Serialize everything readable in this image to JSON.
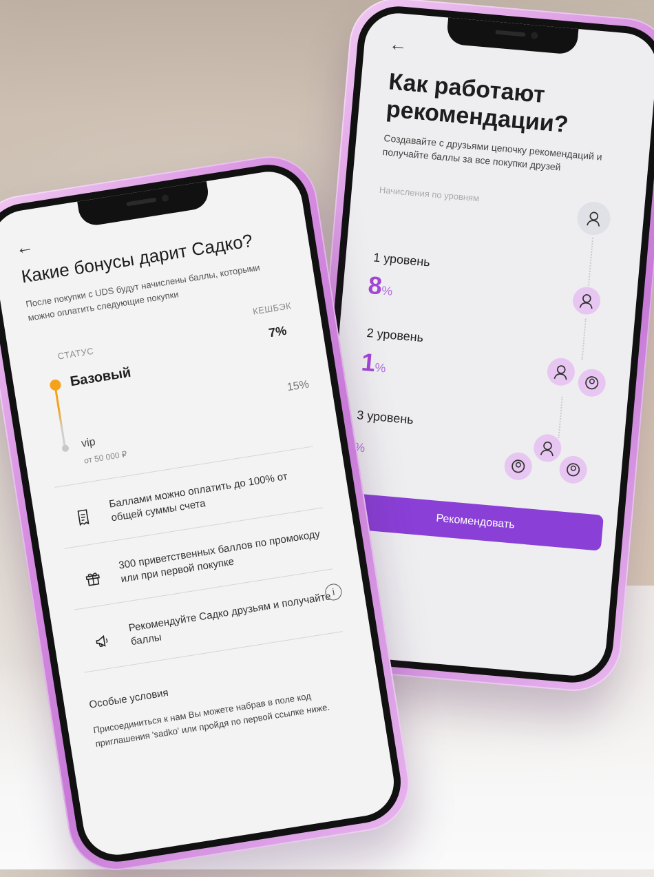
{
  "back_screen": {
    "back_icon": "arrow-left-icon",
    "title": "Как работают рекомендации?",
    "subtitle": "Создавайте с друзьями цепочку рекомендаций и получайте баллы за все покупки друзей",
    "levels_header": "Начисления по уровням",
    "levels": [
      {
        "name": "1 уровень",
        "value": "8",
        "unit": "%"
      },
      {
        "name": "2 уровень",
        "value": "1",
        "unit": "%"
      },
      {
        "name": "3 уровень",
        "value": "",
        "unit": "%"
      }
    ],
    "button_label": "Рекомендовать",
    "accent_color": "#8a3fd6"
  },
  "front_screen": {
    "back_icon": "arrow-left-icon",
    "title": "Какие бонусы дарит Садко?",
    "subtitle": "После покупки с UDS будут начислены баллы, которыми можно оплатить следующие покупки",
    "status_header": "СТАТУС",
    "cashback_header": "КЕШБЭК",
    "statuses": [
      {
        "name": "Базовый",
        "cashback": "7%",
        "condition": ""
      },
      {
        "name": "vip",
        "cashback": "15%",
        "condition": "от 50 000 ₽"
      }
    ],
    "features": [
      {
        "icon": "receipt-icon",
        "text": "Баллами можно оплатить до 100% от общей суммы счета"
      },
      {
        "icon": "gift-icon",
        "text": "300 приветственных баллов по промокоду или при первой покупке"
      },
      {
        "icon": "megaphone-icon",
        "text": "Рекомендуйте Садко друзьям и получайте баллы"
      }
    ],
    "info_icon_glyph": "i",
    "special_header": "Особые условия",
    "special_text": "Присоединиться к нам Вы можете набрав в поле код приглашения 'sadko' или пройдя по первой ссылке ниже.",
    "status_accent": "#f5a21a"
  }
}
